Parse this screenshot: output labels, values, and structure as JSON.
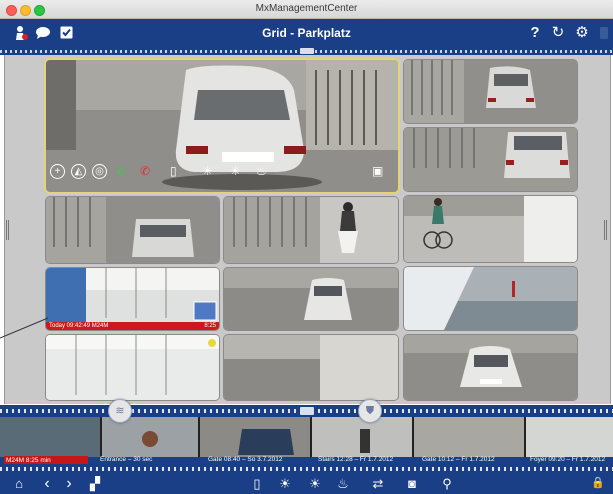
{
  "window": {
    "title": "MxManagementCenter"
  },
  "header": {
    "title": "Grid - Parkplatz",
    "left_icons": [
      "alarm-person-icon",
      "chat-bubble-icon",
      "checkbox-icon"
    ],
    "right_icons": [
      "help-icon",
      "reload-icon",
      "settings-gear-icon"
    ],
    "help_glyph": "?",
    "reload_glyph": "↻",
    "settings_glyph": "⚙"
  },
  "tiles": [
    {
      "id": "main",
      "label": ""
    },
    {
      "id": "focus",
      "label": "Today 09:42:49   M24M",
      "label_right": "8:25 min"
    }
  ],
  "tile_controls": {
    "plus_glyph": "+",
    "zoom_glyph": "◭",
    "ring_glyph": "◎",
    "phone_accept_glyph": "✆",
    "phone_hangup_glyph": "✆",
    "door_glyph": "▯",
    "light1_glyph": "☀",
    "light2_glyph": "☀",
    "thermo_glyph": "♨",
    "record_glyph": "▣"
  },
  "event_strip": {
    "red_label": "M24M  8:25 min",
    "labels": [
      "Entrance – 30 sec",
      "Gate 08:40 – So 3.7.2012",
      "Stairs 12:28 – Fr 1.7.2012",
      "Gate 10:12 – Fr 1.7.2012",
      "Foyer 09:20 – Fr 1.7.2012"
    ]
  },
  "toolbar": {
    "home_glyph": "⌂",
    "back_glyph": "‹",
    "forward_glyph": "›",
    "layout_glyph": "▞",
    "door_glyph": "▯",
    "light1_glyph": "☀",
    "light2_glyph": "☀",
    "thermo_glyph": "♨",
    "switch_glyph": "⇄",
    "snapshot_glyph": "◙",
    "link_glyph": "⚲",
    "lock_glyph": "🔒"
  },
  "colors": {
    "header_blue": "#1a3f86",
    "selected_border": "#e3d479",
    "event_red": "#c41818"
  }
}
